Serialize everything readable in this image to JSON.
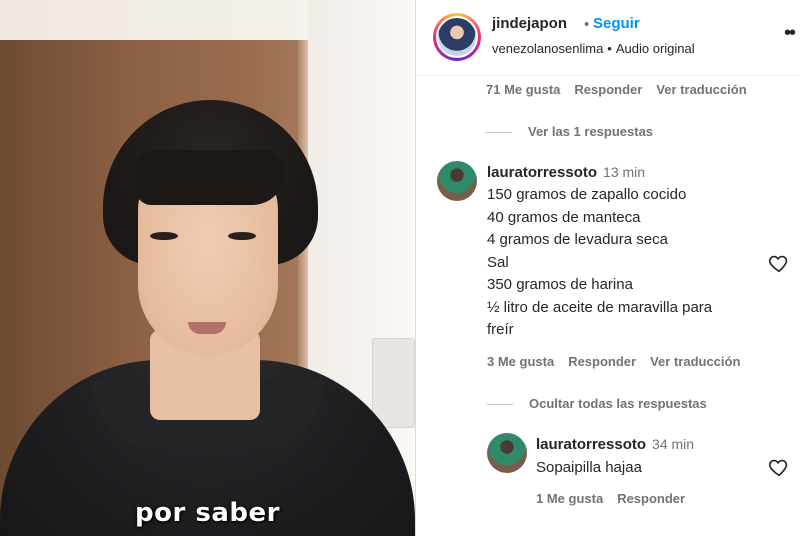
{
  "video": {
    "subtitle": "por saber"
  },
  "header": {
    "username": "jindejapon",
    "separator": "•",
    "follow_label": "Seguir",
    "location": "venezolanosenlima",
    "audio": "Audio original"
  },
  "comments": {
    "top_meta": {
      "likes": "71 Me gusta",
      "reply": "Responder",
      "translate": "Ver traducción"
    },
    "view_replies": "Ver las 1 respuestas",
    "main": {
      "username": "lauratorressoto",
      "time": "13 min",
      "text": "150 gramos de zapallo cocido\n40 gramos de manteca\n4 gramos de levadura seca\nSal\n350 gramos de harina\n½ litro de aceite de maravilla para\nfreír",
      "likes": "3 Me gusta",
      "reply": "Responder",
      "translate": "Ver traducción"
    },
    "hide_replies": "Ocultar todas las respuestas",
    "reply": {
      "username": "lauratorressoto",
      "time": "34 min",
      "text": "Sopaipilla hajaa",
      "likes": "1 Me gusta",
      "reply_label": "Responder"
    }
  },
  "icons": {
    "heart": "heart-outline-icon",
    "more": "more-options-icon"
  }
}
